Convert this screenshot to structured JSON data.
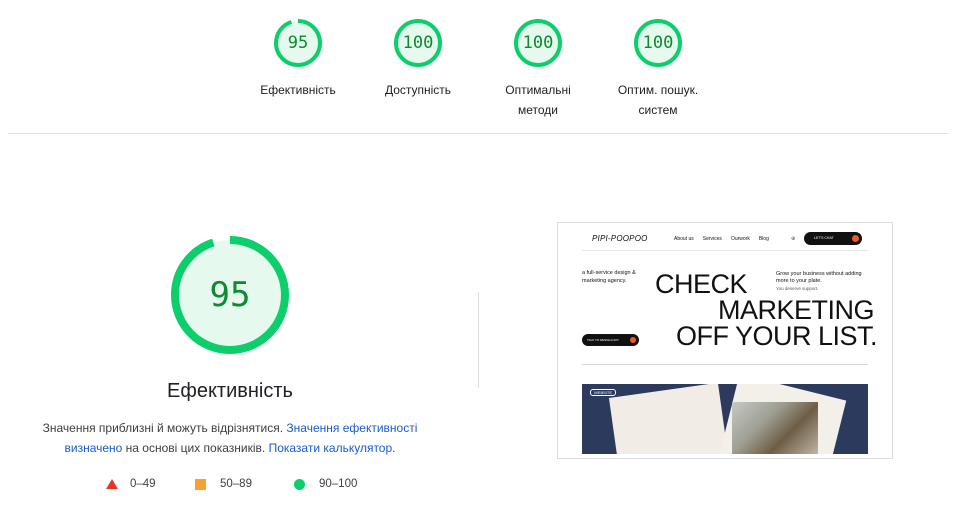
{
  "summary": {
    "gauges": [
      {
        "score": "95",
        "label": "Ефективність",
        "value": 95
      },
      {
        "score": "100",
        "label": "Доступність",
        "value": 100
      },
      {
        "score": "100",
        "label": "Оптимальні методи",
        "value": 100
      },
      {
        "score": "100",
        "label": "Оптим. пошук. систем",
        "value": 100
      }
    ]
  },
  "main": {
    "score": "95",
    "value": 95,
    "title": "Ефективність",
    "note_text": "Значення приблизні й можуть відрізнятися. ",
    "note_link1": "Значення ефективності визначено",
    "note_mid": " на основі цих показників. ",
    "note_link2": "Показати калькулятор",
    "note_end": "."
  },
  "legend": [
    {
      "range": "0–49",
      "shape": "triangle",
      "color": "#eb3323"
    },
    {
      "range": "50–89",
      "shape": "square",
      "color": "#f6a22e"
    },
    {
      "range": "90–100",
      "shape": "circle",
      "color": "#0cce6b"
    }
  ],
  "thumbnail": {
    "logo": "PIPI-POOPOO",
    "nav_links": [
      "About us",
      "Services",
      "Ourwork",
      "Blog"
    ],
    "chat": "LET'S CHAT",
    "intro": "a full-service design & marketing agency.",
    "headline": [
      "CHECK",
      "MARKETING",
      "OFF YOUR LIST."
    ],
    "right_text": "Grow your business without adding more to your plate.",
    "right_sub": "You deserve support.",
    "button": "TALK TO DESIGN-NOT",
    "badge": "WEBSITE"
  },
  "colors": {
    "pass_green": "#0cce6b",
    "pass_text": "#0c8a2e",
    "pass_bg": "#e6f9ef",
    "link": "#1a5bd1"
  }
}
